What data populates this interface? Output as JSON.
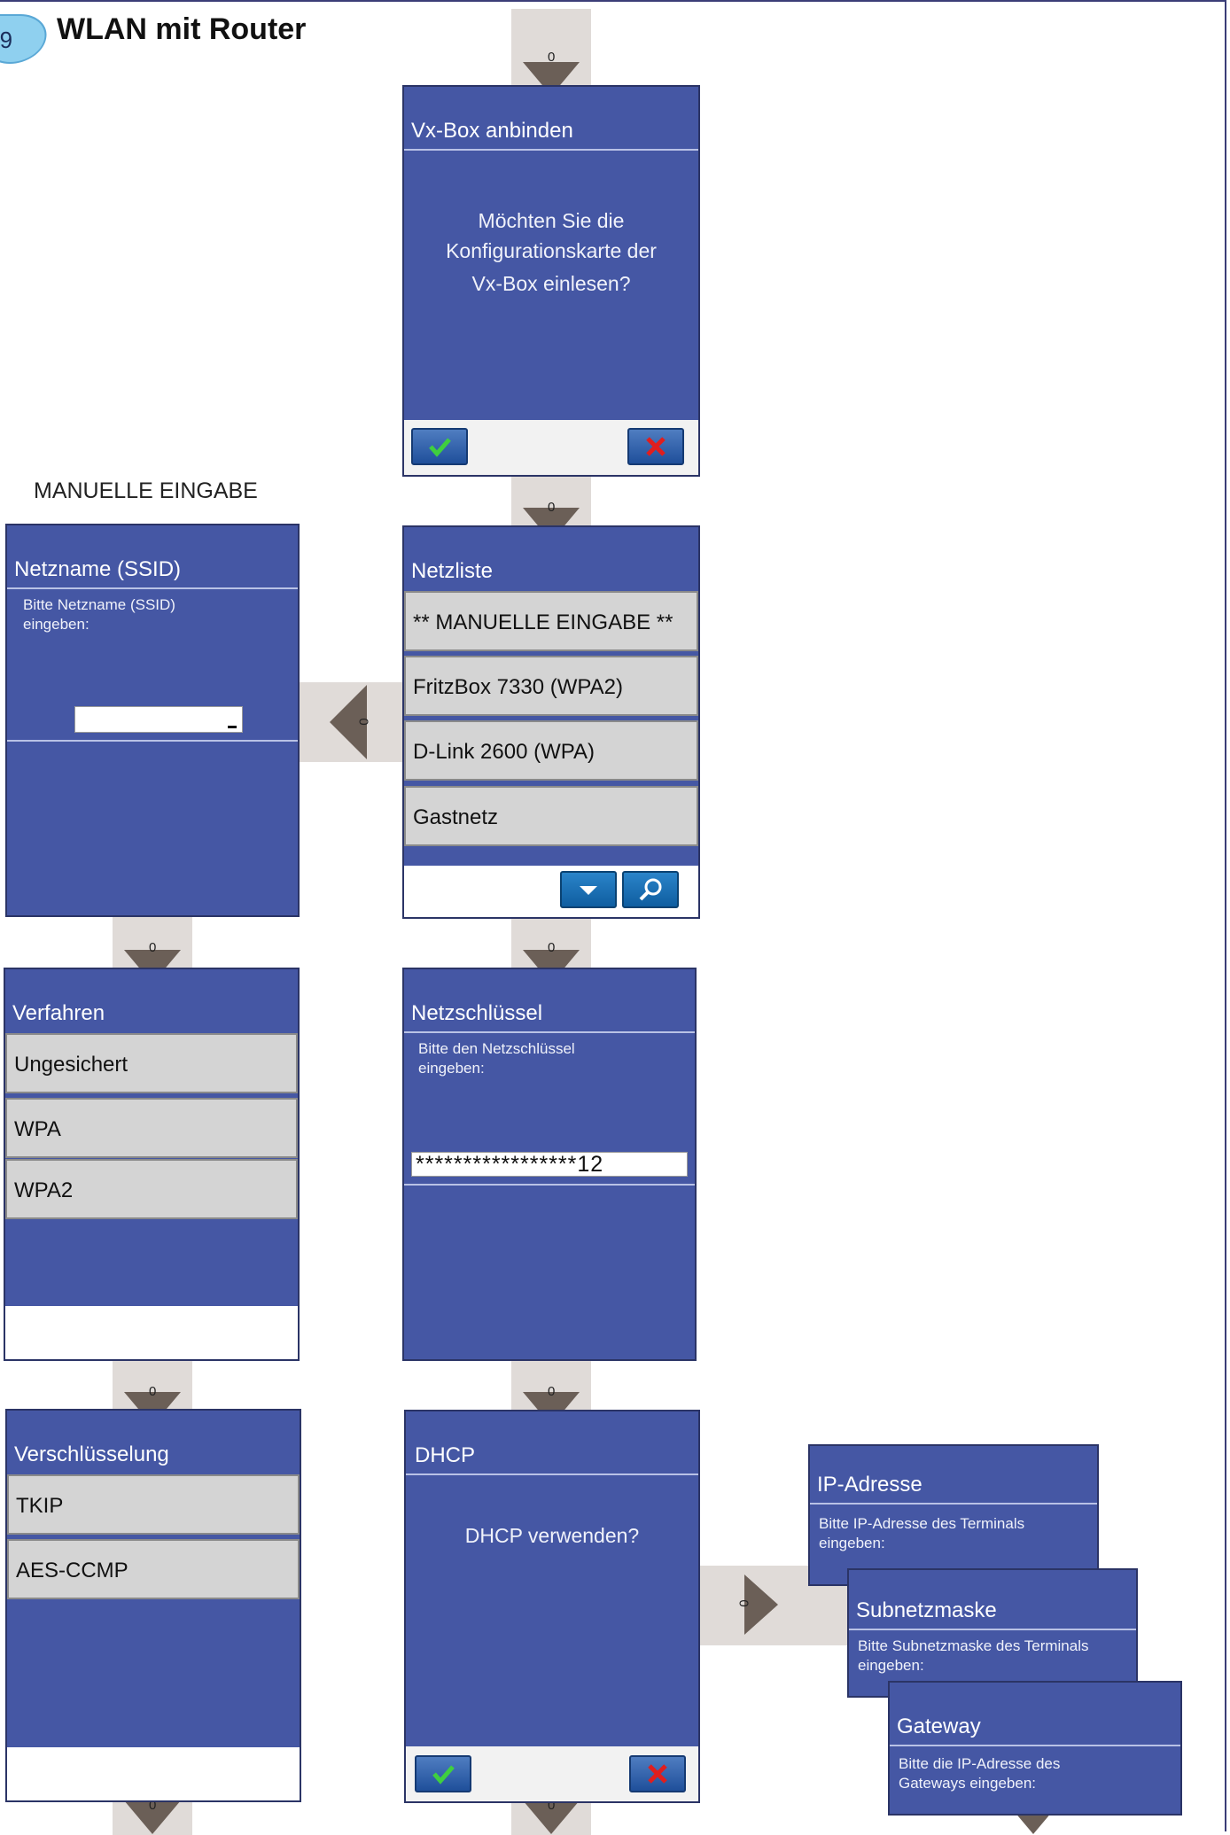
{
  "header": {
    "badge": "9",
    "title": "WLAN mit Router"
  },
  "manual_label": "MANUELLE EINGABE",
  "flow_marker": "0",
  "screens": {
    "vx_box": {
      "title": "Vx-Box anbinden",
      "message_lines": [
        "Möchten Sie die",
        "Konfigurationskarte der",
        "Vx-Box einlesen?"
      ]
    },
    "netzliste": {
      "title": "Netzliste",
      "items": [
        "** MANUELLE EINGABE **",
        "FritzBox 7330 (WPA2)",
        "D-Link 2600 (WPA)",
        "Gastnetz"
      ]
    },
    "ssid": {
      "title": "Netzname (SSID)",
      "prompt_lines": [
        "Bitte Netzname (SSID)",
        "eingeben:"
      ],
      "value": ""
    },
    "verfahren": {
      "title": "Verfahren",
      "items": [
        "Ungesichert",
        "WPA",
        "WPA2"
      ]
    },
    "netzschluessel": {
      "title": "Netzschlüssel",
      "prompt_lines": [
        "Bitte den Netzschlüssel",
        "eingeben:"
      ],
      "value": "*****************12"
    },
    "verschluesselung": {
      "title": "Verschlüsselung",
      "items": [
        "TKIP",
        "AES-CCMP"
      ]
    },
    "dhcp": {
      "title": "DHCP",
      "message": "DHCP verwenden?"
    },
    "ip": {
      "title": "IP-Adresse",
      "prompt_lines": [
        "Bitte IP-Adresse des Terminals",
        "eingeben:"
      ]
    },
    "subnet": {
      "title": "Subnetzmaske",
      "prompt_lines": [
        "Bitte Subnetzmaske des Terminals",
        "eingeben:"
      ]
    },
    "gateway": {
      "title": "Gateway",
      "prompt_lines": [
        "Bitte die IP-Adresse des",
        "Gateways eingeben:"
      ]
    }
  },
  "colors": {
    "screen": "#4557a4",
    "connector": "#e0dbd8",
    "arrow": "#6b5f57",
    "ok": "#3fcf3f",
    "cancel": "#e01e1e"
  }
}
